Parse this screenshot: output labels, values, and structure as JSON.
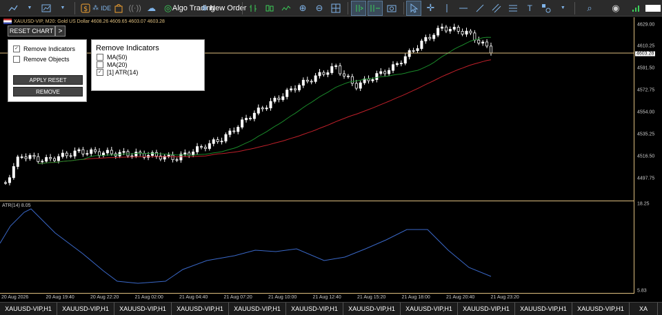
{
  "toolbar": {
    "algo_trading_label": "Algo Trading",
    "new_order_label": "New Order",
    "ide_label": "IDE"
  },
  "chart": {
    "symbol_info": "XAUUSD-VIP, M20:  Gold US Dollar   4608.26 4609.65 4603.07 4603.28",
    "current_price": "4603.28",
    "price_axis": [
      "4629.00",
      "4610.25",
      "4591.50",
      "4572.75",
      "4554.00",
      "4535.25",
      "4516.50",
      "4497.75"
    ],
    "indicator_axis": [
      "18.25",
      "5.83"
    ],
    "time_axis": [
      "20 Aug 2026",
      "20 Aug 19:40",
      "20 Aug 22:20",
      "21 Aug 02:00",
      "21 Aug 04:40",
      "21 Aug 07:20",
      "21 Aug 10:00",
      "21 Aug 12:40",
      "21 Aug 15:20",
      "21 Aug 18:00",
      "21 Aug 20:40",
      "21 Aug 23:20"
    ],
    "indicator_label": "ATR(14) 8.05"
  },
  "controls": {
    "reset_chart_label": "RESET CHART",
    "expand_label": ">",
    "remove_indicators_label": "Remove Indicators",
    "remove_indicators_checked": "✓",
    "remove_objects_label": "Remove Objects",
    "apply_reset_label": "APPLY RESET",
    "remove_label": "REMOVE"
  },
  "indicator_panel": {
    "title": "Remove Indicators",
    "items": [
      {
        "label": "MA(50)",
        "check": ""
      },
      {
        "label": "MA(20)",
        "check": ""
      },
      {
        "label": "[1] ATR(14)",
        "check": "✓"
      }
    ]
  },
  "tabs": [
    "XAUUSD-VIP,H1",
    "XAUUSD-VIP,H1",
    "XAUUSD-VIP,H1",
    "XAUUSD-VIP,H1",
    "XAUUSD-VIP,H1",
    "XAUUSD-VIP,H1",
    "XAUUSD-VIP,H1",
    "XAUUSD-VIP,H1",
    "XAUUSD-VIP,H1",
    "XAUUSD-VIP,H1",
    "XAUUSD-VIP,H1",
    "XA"
  ],
  "colors": {
    "ma_fast": "#1a8a2a",
    "ma_slow": "#c0202a",
    "atr": "#3a68c8",
    "price_line": "#e0c080",
    "candle": "#ffffff"
  }
}
